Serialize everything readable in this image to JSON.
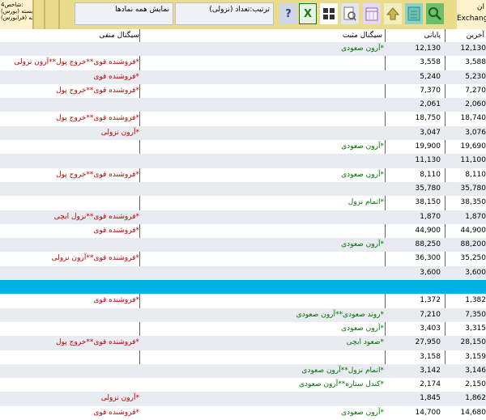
{
  "toolbar": {
    "status_lines": [
      "شاخص4:",
      "(بورس) بسته -",
      "(فرابورس) بسته"
    ],
    "show_all_symbols": "نمایش همه نمادها",
    "sort_label": "ترتیب:تعداد (نزولی)",
    "exchange_title": "ان",
    "exchange_label": "Exchang",
    "icons": [
      "help-icon",
      "excel-icon",
      "grid-icon",
      "preview-icon",
      "calendar-icon",
      "up-icon",
      "notes-icon",
      "search-icon",
      "home-icon"
    ]
  },
  "table": {
    "headers": {
      "negative": "سیگنال منفی",
      "positive": "سیگنال مثبت",
      "final": "پایانی",
      "last": "آخرین"
    },
    "rows": [
      {
        "neg": "",
        "pos": "*آرون صعودی",
        "final": "12,130",
        "last": "12,130",
        "style": "alt"
      },
      {
        "neg": "*فروشنده قوی**خروج پول**آرون نزولی",
        "pos": "",
        "final": "3,558",
        "last": "3,588",
        "style": ""
      },
      {
        "neg": "*فروشنده قوی",
        "pos": "",
        "final": "5,240",
        "last": "5,230",
        "style": "alt"
      },
      {
        "neg": "*فروشنده قوی**خروج پول",
        "pos": "",
        "final": "7,370",
        "last": "7,270",
        "style": ""
      },
      {
        "neg": "",
        "pos": "",
        "final": "2,061",
        "last": "2,060",
        "style": "alt"
      },
      {
        "neg": "*فروشنده قوی**خروج پول",
        "pos": "",
        "final": "18,750",
        "last": "18,740",
        "style": ""
      },
      {
        "neg": "*آرون نزولی",
        "pos": "",
        "final": "3,047",
        "last": "3,076",
        "style": "alt"
      },
      {
        "neg": "",
        "pos": "*آرون صعودی",
        "final": "19,900",
        "last": "19,690",
        "style": ""
      },
      {
        "neg": "",
        "pos": "",
        "final": "11,130",
        "last": "11,100",
        "style": "alt"
      },
      {
        "neg": "*فروشنده قوی**خروج پول",
        "pos": "*آرون صعودی",
        "final": "8,110",
        "last": "8,110",
        "style": ""
      },
      {
        "neg": "",
        "pos": "",
        "final": "35,780",
        "last": "35,780",
        "style": "alt"
      },
      {
        "neg": "",
        "pos": "*اتمام نزول",
        "final": "38,150",
        "last": "38,350",
        "style": ""
      },
      {
        "neg": "*فروشنده قوی**نزول ابچی",
        "pos": "",
        "final": "1,870",
        "last": "1,870",
        "style": "alt"
      },
      {
        "neg": "*فروشنده قوی",
        "pos": "",
        "final": "44,900",
        "last": "44,900",
        "style": ""
      },
      {
        "neg": "",
        "pos": "*آرون صعودی",
        "final": "88,250",
        "last": "88,200",
        "style": "alt"
      },
      {
        "neg": "*فروشنده قوی**آرون نزولی",
        "pos": "",
        "final": "36,300",
        "last": "35,250",
        "style": ""
      },
      {
        "neg": "",
        "pos": "",
        "final": "3,600",
        "last": "3,600",
        "style": "alt"
      },
      {
        "neg": "",
        "pos": "",
        "final": "",
        "last": "",
        "style": "blue"
      },
      {
        "neg": "*فروشنده قوی",
        "pos": "",
        "final": "1,372",
        "last": "1,382",
        "style": ""
      },
      {
        "neg": "",
        "pos": "*روند صعودی**آرون صعودی",
        "final": "7,210",
        "last": "7,350",
        "style": "alt"
      },
      {
        "neg": "",
        "pos": "*آرون صعودی",
        "final": "3,403",
        "last": "3,315",
        "style": ""
      },
      {
        "neg": "*فروشنده قوی**خروج پول",
        "pos": "*صعود ابچی",
        "final": "27,950",
        "last": "28,150",
        "style": "alt"
      },
      {
        "neg": "",
        "pos": "",
        "final": "3,158",
        "last": "3,159",
        "style": ""
      },
      {
        "neg": "",
        "pos": "*اتمام نزول**آرون صعودی",
        "final": "3,142",
        "last": "3,146",
        "style": "alt"
      },
      {
        "neg": "",
        "pos": "*کندل ستاره**آرون صعودی",
        "final": "2,174",
        "last": "2,150",
        "style": ""
      },
      {
        "neg": "*آرون نزولی",
        "pos": "",
        "final": "1,845",
        "last": "1,862",
        "style": "alt"
      },
      {
        "neg": "*فروشنده قوی",
        "pos": "*آرون صعودی",
        "final": "14,700",
        "last": "14,680",
        "style": ""
      }
    ]
  }
}
